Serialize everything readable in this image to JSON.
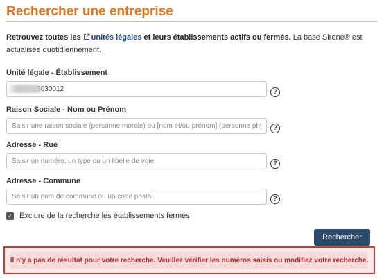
{
  "page": {
    "title": "Rechercher une entreprise"
  },
  "intro": {
    "lead": "Retrouvez toutes les",
    "link": "unités légales",
    "bold_tail": "et leurs établissements actifs ou fermés.",
    "tail": "La base Sirene® est actualisée quotidiennement."
  },
  "fields": [
    {
      "label": "Unité légale - Établissement",
      "value": "          ...5030012",
      "placeholder": ""
    },
    {
      "label": "Raison Sociale - Nom ou Prénom",
      "value": "",
      "placeholder": "Saisir une raison sociale (personne morale) ou [nom et/ou prénom] (personne physique)"
    },
    {
      "label": "Adresse - Rue",
      "value": "",
      "placeholder": "Saisir un numéro, un type ou un libellé de voie"
    },
    {
      "label": "Adresse - Commune",
      "value": "",
      "placeholder": "Saisir un nom de commune ou un code postal"
    }
  ],
  "help_glyph": "?",
  "checkbox": {
    "label": "Exclure de la recherche les établissements fermés",
    "checked": true,
    "mark": "✓"
  },
  "search_button": {
    "label": "Rechercher"
  },
  "error": {
    "message": "Il n'y a pas de résultat pour votre recherche. Veuillez vérifier les numéros saisis ou modifiez votre recherche."
  },
  "colors": {
    "title": "#e8731a",
    "link": "#1f4a8c",
    "button": "#2b4a6b",
    "error_border": "#d9322f",
    "error_text": "#b22a25"
  }
}
